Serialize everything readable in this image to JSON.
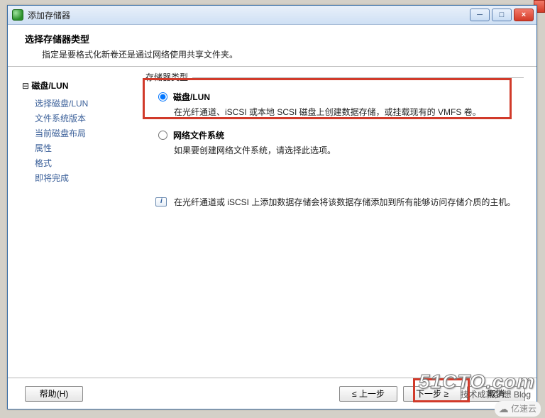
{
  "window": {
    "title": "添加存储器",
    "btn_min": "─",
    "btn_max": "□",
    "btn_close": "×"
  },
  "header": {
    "title": "选择存储器类型",
    "subtitle": "指定是要格式化新卷还是通过网络使用共享文件夹。"
  },
  "nav": {
    "root": "磁盘/LUN",
    "items": [
      "选择磁盘/LUN",
      "文件系统版本",
      "当前磁盘布局",
      "属性",
      "格式",
      "即将完成"
    ]
  },
  "content": {
    "fieldset_label": "存储器类型",
    "options": [
      {
        "label": "磁盘/LUN",
        "desc": "在光纤通道、iSCSI 或本地 SCSI 磁盘上创建数据存储，或挂载现有的 VMFS 卷。",
        "checked": true
      },
      {
        "label": "网络文件系统",
        "desc": "如果要创建网络文件系统，请选择此选项。",
        "checked": false
      }
    ],
    "info": "在光纤通道或 iSCSI 上添加数据存储会将该数据存储添加到所有能够访问存储介质的主机。"
  },
  "footer": {
    "help": "帮助(H)",
    "back": "≤ 上一步",
    "next": "下一步 ≥",
    "cancel": "取消"
  },
  "watermark": {
    "main": "51CTO.com",
    "sub": "技术成就梦想  Blog",
    "badge": "亿速云"
  }
}
